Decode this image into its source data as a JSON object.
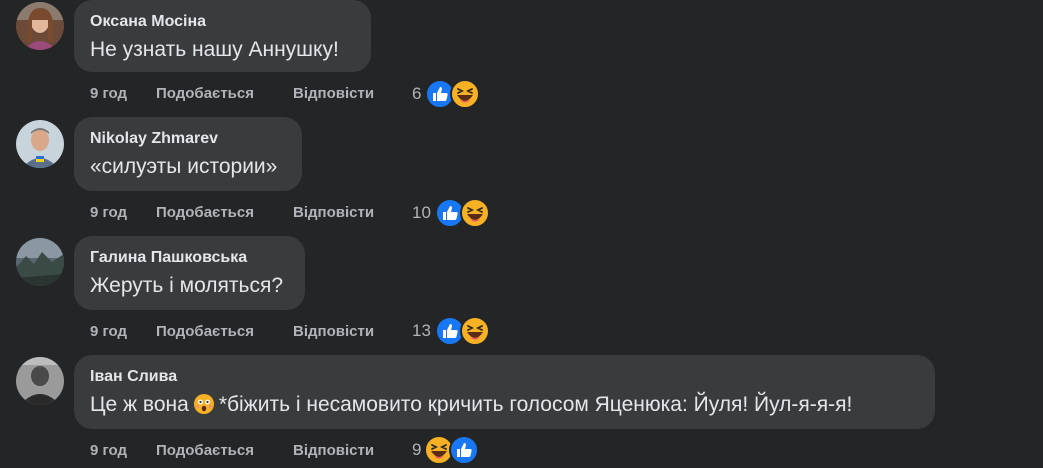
{
  "comments": [
    {
      "author": "Оксана Мосіна",
      "text": "Не узнать нашу Аннушку!",
      "time": "9 год",
      "like_label": "Подобається",
      "reply_label": "Відповісти",
      "reaction_count": "6",
      "reactions": [
        "like-icon",
        "haha-icon"
      ]
    },
    {
      "author": "Nikolay Zhmarev",
      "text": "«силуэты истории»",
      "time": "9 год",
      "like_label": "Подобається",
      "reply_label": "Відповісти",
      "reaction_count": "10",
      "reactions": [
        "like-icon",
        "haha-icon"
      ]
    },
    {
      "author": "Галина Пашковська",
      "text": "Жеруть і моляться?",
      "time": "9 год",
      "like_label": "Подобається",
      "reply_label": "Відповісти",
      "reaction_count": "13",
      "reactions": [
        "like-icon",
        "haha-icon"
      ]
    },
    {
      "author": "Іван Слива",
      "text_before": "Це ж вона",
      "text_emoji": "astonished-face-icon",
      "text_after": "*біжить і несамовито кричить голосом Яценюка: Йуля! Йул-я-я-я!",
      "time": "9 год",
      "like_label": "Подобається",
      "reply_label": "Відповісти",
      "reaction_count": "9",
      "reactions": [
        "haha-icon",
        "like-icon"
      ]
    }
  ],
  "colors": {
    "background": "#242526",
    "bubble": "#3a3b3c",
    "text": "#e4e6eb",
    "secondary_text": "#b0b3b8",
    "like_blue": "#1877f2",
    "haha_yellow": "#f7b125"
  }
}
